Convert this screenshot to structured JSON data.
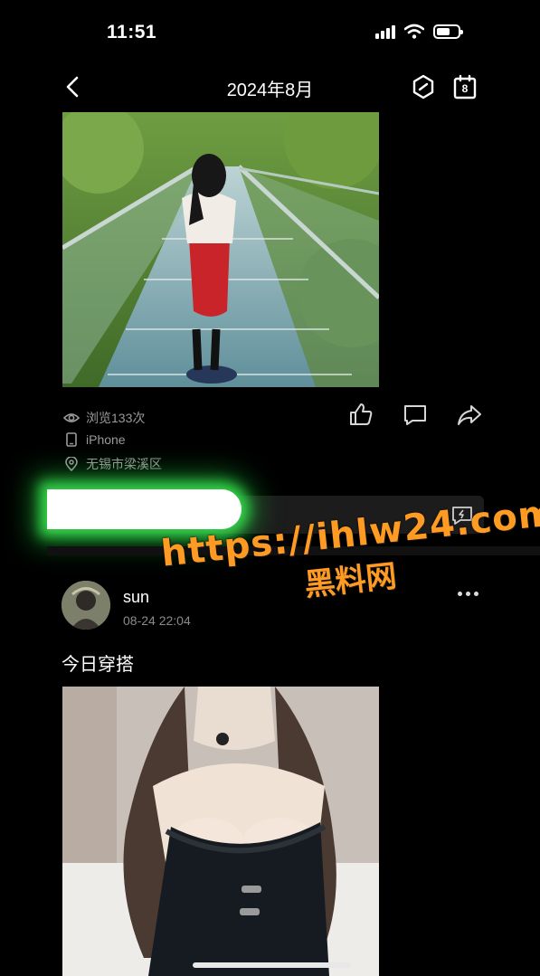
{
  "status_bar": {
    "time": "11:51"
  },
  "nav": {
    "title": "2024年8月",
    "calendar_day": "8"
  },
  "post1": {
    "views": "浏览133次",
    "device": "iPhone",
    "location": "无锡市梁溪区"
  },
  "post2": {
    "username": "sun",
    "time": "08-24 22:04",
    "text": "今日穿搭"
  },
  "watermark": {
    "url": "https://ihlw24.com",
    "name": "黑料网"
  },
  "colors": {
    "background": "#000000",
    "watermark": "#ff9a22",
    "glow": "#35d24a",
    "meta_text": "#9a9a9a"
  }
}
